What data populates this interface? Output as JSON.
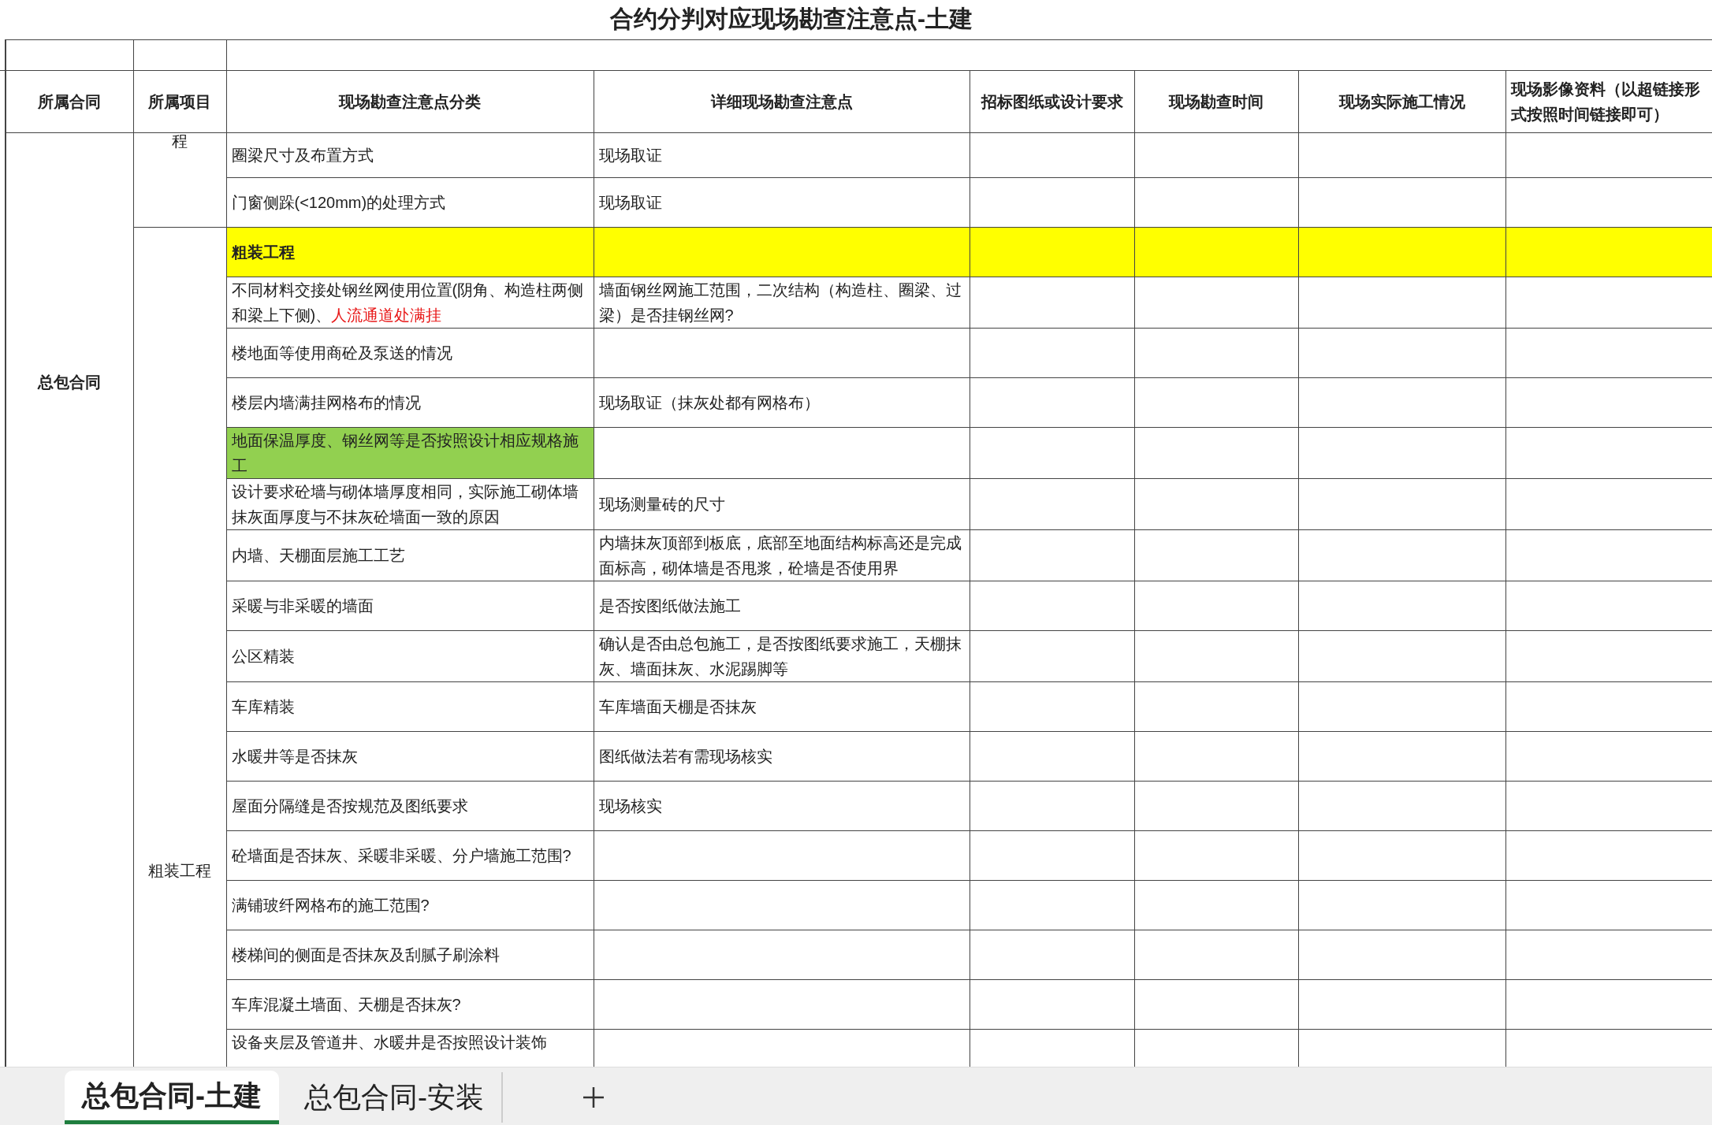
{
  "title": "合约分判对应现场勘查注意点-土建",
  "columns": [
    "所属合同",
    "所属项目",
    "现场勘查注意点分类",
    "详细现场勘查注意点",
    "招标图纸或设计要求",
    "现场勘查时间",
    "现场实际施工情况",
    "现场影像资料（以超链接形式按照时间链接即可）"
  ],
  "contract": "总包合同",
  "projects": [
    {
      "name": "程",
      "rows": [
        {
          "kind": "item",
          "category": "圈梁尺寸及布置方式",
          "detail": "现场取证"
        },
        {
          "kind": "item",
          "category": "门窗侧跺(<120mm)的处理方式",
          "detail": "现场取证"
        }
      ]
    },
    {
      "name": "粗装工程",
      "rows": [
        {
          "kind": "section",
          "category": "粗装工程"
        },
        {
          "kind": "item",
          "category": "不同材料交接处钢丝网使用位置(阴角、构造柱两侧和梁上下侧)、",
          "category_note": "人流通道处满挂",
          "detail": "墙面钢丝网施工范围，二次结构（构造柱、圈梁、过梁）是否挂钢丝网?"
        },
        {
          "kind": "item",
          "category": "楼地面等使用商砼及泵送的情况"
        },
        {
          "kind": "item",
          "category": "楼层内墙满挂网格布的情况",
          "detail": "现场取证（抹灰处都有网格布）"
        },
        {
          "kind": "marked",
          "category": "地面保温厚度、钢丝网等是否按照设计相应规格施工"
        },
        {
          "kind": "item",
          "category": "设计要求砼墙与砌体墙厚度相同，实际施工砌体墙抹灰面厚度与不抹灰砼墙面一致的原因",
          "detail": "现场测量砖的尺寸"
        },
        {
          "kind": "item",
          "category": "内墙、天棚面层施工工艺",
          "detail": "内墙抹灰顶部到板底，底部至地面结构标高还是完成面标高，砌体墙是否甩浆，砼墙是否使用界"
        },
        {
          "kind": "item",
          "category": "采暖与非采暖的墙面",
          "detail": "是否按图纸做法施工"
        },
        {
          "kind": "item",
          "category": "公区精装",
          "detail": "确认是否由总包施工，是否按图纸要求施工，天棚抹灰、墙面抹灰、水泥踢脚等"
        },
        {
          "kind": "item",
          "category": "车库精装",
          "detail": "车库墙面天棚是否抹灰"
        },
        {
          "kind": "item",
          "category": "水暖井等是否抹灰",
          "detail": "图纸做法若有需现场核实"
        },
        {
          "kind": "item",
          "category": "屋面分隔缝是否按规范及图纸要求",
          "detail": "现场核实"
        },
        {
          "kind": "item",
          "category": "砼墙面是否抹灰、采暖非采暖、分户墙施工范围?"
        },
        {
          "kind": "item",
          "category": "满铺玻纤网格布的施工范围?"
        },
        {
          "kind": "item",
          "category": "楼梯间的侧面是否抹灰及刮腻子刷涂料"
        },
        {
          "kind": "item",
          "category": "车库混凝土墙面、天棚是否抹灰?"
        },
        {
          "kind": "item",
          "category": "设备夹层及管道井、水暖井是否按照设计装饰"
        }
      ]
    }
  ],
  "sheet_tabs": [
    {
      "label": "总包合同-土建",
      "selected": true
    },
    {
      "label": "总包合同-安装",
      "selected": false
    }
  ]
}
